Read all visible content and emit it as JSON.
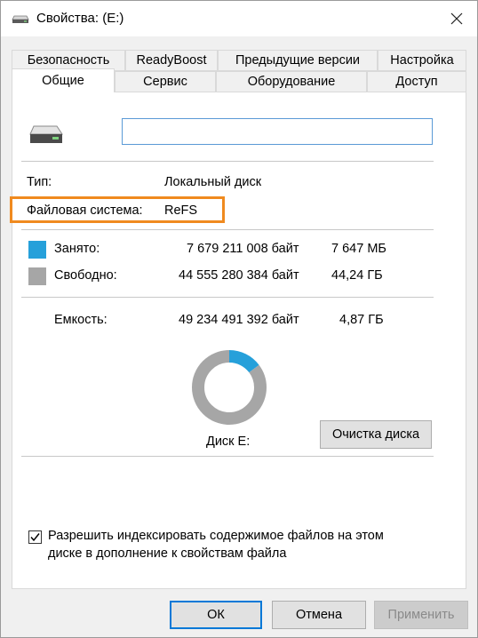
{
  "window": {
    "title": "Свойства: (E:)"
  },
  "tabs": {
    "row_back": [
      "Безопасность",
      "ReadyBoost",
      "Предыдущие версии",
      "Настройка"
    ],
    "row_front": [
      "Общие",
      "Сервис",
      "Оборудование",
      "Доступ"
    ],
    "active": "Общие"
  },
  "general": {
    "volume_name_value": "",
    "type_label": "Тип:",
    "type_value": "Локальный диск",
    "fs_label": "Файловая система:",
    "fs_value": "ReFS",
    "used_label": "Занято:",
    "used_bytes": "7 679 211 008 байт",
    "used_size": "7 647 МБ",
    "free_label": "Свободно:",
    "free_bytes": "44 555 280 384 байт",
    "free_size": "44,24 ГБ",
    "capacity_label": "Емкость:",
    "capacity_bytes": "49 234 491 392 байт",
    "capacity_size": "4,87 ГБ",
    "disk_label": "Диск E:",
    "cleanup_button": "Очистка диска",
    "index_checkbox_label_line1": "Разрешить индексировать содержимое файлов на этом",
    "index_checkbox_label_line2": "диске в дополнение к свойствам файла",
    "index_checked": true
  },
  "chart_data": {
    "type": "pie",
    "categories": [
      "Занято",
      "Свободно"
    ],
    "values": [
      7679211008,
      44555280384
    ],
    "colors": [
      "#26a0da",
      "#a6a6a6"
    ],
    "title": "Диск E:"
  },
  "colors": {
    "used": "#26a0da",
    "free": "#a6a6a6",
    "accent": "#0078d7",
    "highlight": "#f08a1f"
  },
  "buttons": {
    "ok": "ОК",
    "cancel": "Отмена",
    "apply": "Применить"
  },
  "icons": {
    "title": "drive-icon",
    "close": "close-icon",
    "drive": "drive-icon",
    "check": "checkmark-icon"
  }
}
